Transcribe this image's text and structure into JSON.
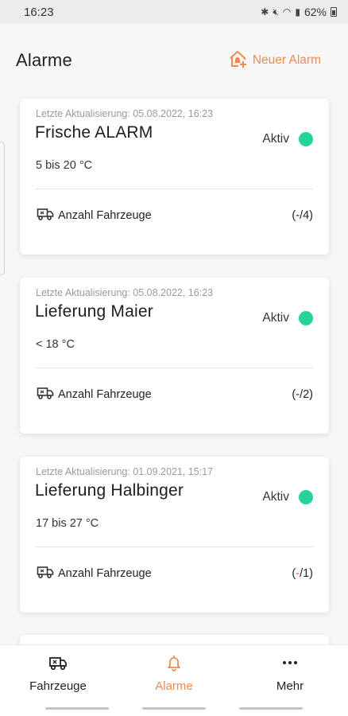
{
  "status_bar": {
    "time": "16:23",
    "battery": "62%"
  },
  "header": {
    "title": "Alarme",
    "new_alarm_label": "Neuer Alarm"
  },
  "alarms": [
    {
      "updated": "Letzte Aktualisierung: 05.08.2022, 16:23",
      "name": "Frische ALARM",
      "status": "Aktiv",
      "temperature": "5 bis 20 °C",
      "vehicles_label": "Anzahl Fahrzeuge",
      "count_open": "(",
      "count_dash": "-",
      "count_rest": "/4)"
    },
    {
      "updated": "Letzte Aktualisierung: 05.08.2022, 16:23",
      "name": "Lieferung Maier",
      "status": "Aktiv",
      "temperature": "< 18 °C",
      "vehicles_label": "Anzahl Fahrzeuge",
      "count_open": "(",
      "count_dash": "-",
      "count_rest": "/2)"
    },
    {
      "updated": "Letzte Aktualisierung: 01.09.2021, 15:17",
      "name": "Lieferung Halbinger",
      "status": "Aktiv",
      "temperature": "17 bis 27 °C",
      "vehicles_label": "Anzahl Fahrzeuge",
      "count_open": "(",
      "count_dash": "-",
      "count_rest": "/1)"
    }
  ],
  "nav": {
    "vehicles": "Fahrzeuge",
    "alarms": "Alarme",
    "more": "Mehr"
  },
  "colors": {
    "accent": "#f08a4b",
    "active_status": "#25d39c"
  }
}
